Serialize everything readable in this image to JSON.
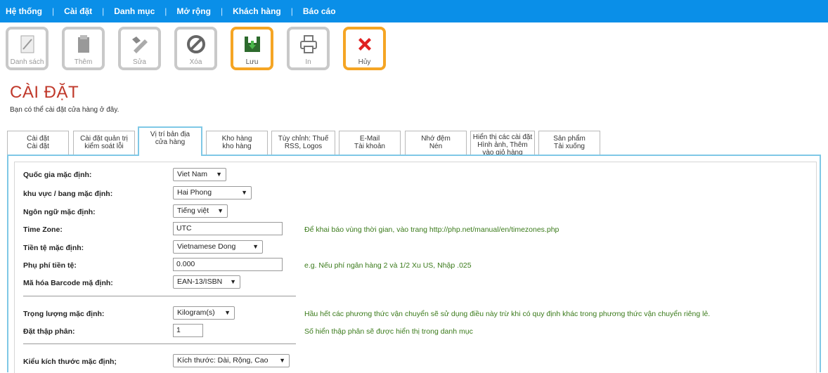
{
  "menu": [
    "Hệ thống",
    "Cài đặt",
    "Danh mục",
    "Mở rộng",
    "Khách hàng",
    "Báo cáo"
  ],
  "toolbar": {
    "list": "Danh sách",
    "add": "Thêm",
    "edit": "Sửa",
    "delete": "Xóa",
    "save": "Lưu",
    "print": "In",
    "cancel": "Hủy"
  },
  "page": {
    "title": "CÀI ĐẶT",
    "subtitle": "Bạn có thể cài đặt cửa hàng ở đây."
  },
  "tabs": [
    {
      "l1": "Cài đặt",
      "l2": "Cài đặt"
    },
    {
      "l1": "Cài đặt quản trị",
      "l2": "kiểm soát lỗi"
    },
    {
      "l1": "Vị trí bản địa",
      "l2": "cửa hàng"
    },
    {
      "l1": "Kho hàng",
      "l2": "kho hàng"
    },
    {
      "l1": "Tùy chỉnh: Thuế",
      "l2": "RSS, Logos"
    },
    {
      "l1": "E-Mail",
      "l2": "Tài khoản"
    },
    {
      "l1": "Nhớ đệm",
      "l2": "Nén"
    },
    {
      "l1": "Hiển thị các cài đặt",
      "l2": "Hình ảnh, Thêm",
      "l3": "vào giỏ hàng"
    },
    {
      "l1": "Sản phẩm",
      "l2": "Tải xuống"
    }
  ],
  "form": {
    "country": {
      "label": "Quốc gia mặc định:",
      "value": "Viet Nam"
    },
    "region": {
      "label": "khu vực / bang mặc định:",
      "value": "Hai Phong"
    },
    "language": {
      "label": "Ngôn ngữ mặc định:",
      "value": "Tiếng việt"
    },
    "timezone": {
      "label": "Time Zone:",
      "value": "UTC",
      "hint": "Để khai báo vùng thời gian, vào trang http://php.net/manual/en/timezones.php"
    },
    "currency": {
      "label": "Tiền tệ mặc định:",
      "value": "Vietnamese Dong"
    },
    "fee": {
      "label": "Phụ phí tiền tệ:",
      "value": "0.000",
      "hint": "e.g. Nếu phí ngân hàng 2 và 1/2 Xu US, Nhập .025"
    },
    "barcode": {
      "label": "Mã hóa Barcode mặ định:",
      "value": "EAN-13/ISBN"
    },
    "weight": {
      "label": "Trọng lượng mặc định:",
      "value": "Kilogram(s)",
      "hint": "Hầu hết các phương thức vận chuyển sẽ sử dụng điều này trừ khi có quy định khác trong phương thức vận chuyển riêng lẻ."
    },
    "decimal": {
      "label": "Đặt thập phân:",
      "value": "1",
      "hint": "Số hiển thập phân sẽ được hiển thị trong danh mục"
    },
    "size": {
      "label": "Kiểu kích thước mặc định;",
      "value": "Kích thước: Dài, Rộng, Cao"
    }
  }
}
